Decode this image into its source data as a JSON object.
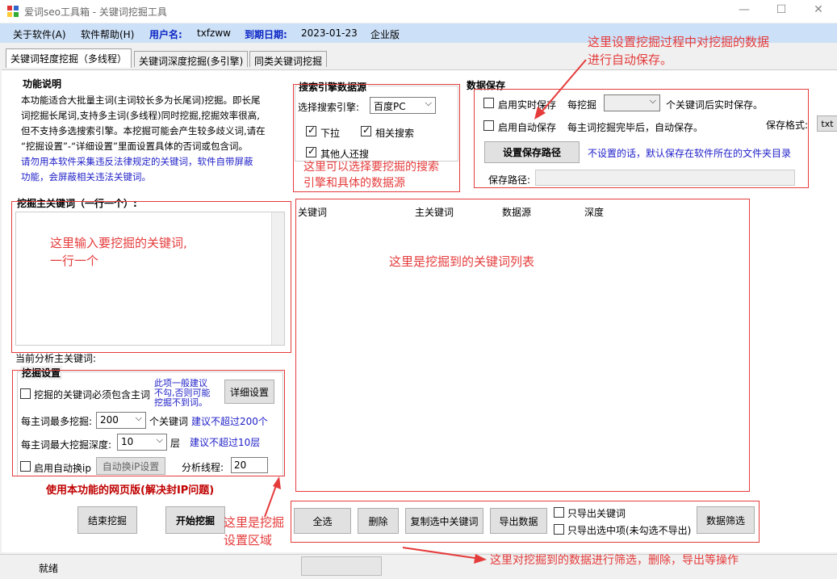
{
  "window": {
    "title": "爱词seo工具箱 - 关键词挖掘工具"
  },
  "menu": {
    "about": "关于软件(A)",
    "help": "软件帮助(H)",
    "user_label": "用户名:",
    "user": "txfzww",
    "expire_label": "到期日期:",
    "expire": "2023-01-23",
    "edition": "企业版"
  },
  "tabs": [
    "关键词轻度挖掘（多线程）",
    "关键词深度挖掘(多引擎)",
    "同类关键词挖掘"
  ],
  "func": {
    "title": "功能说明",
    "lines": [
      "本功能适合大批量主词(主词较长多为长尾词)挖掘。即长尾",
      "词挖掘长尾词,支持多主词(多线程)同时挖掘,挖掘效率很高,",
      "但不支持多选搜索引擎。本挖掘可能会产生较多歧义词,请在",
      "“挖掘设置”-“详细设置”里面设置具体的否词或包含词。"
    ],
    "warn": [
      "请勿用本软件采集违反法律规定的关键词，软件自带屏蔽",
      "功能，会屏蔽相关违法关键词。"
    ]
  },
  "engine": {
    "title": "搜索引擎数据源",
    "select_label": "选择搜索引擎:",
    "select_value": "百度PC",
    "cb1": "下拉",
    "cb2": "相关搜索",
    "cb3": "其他人还搜"
  },
  "save": {
    "title": "数据保存",
    "realtime": "启用实时保存",
    "every": "每挖掘",
    "after": "个关键词后实时保存。",
    "auto": "启用自动保存",
    "auto_desc": "每主词挖掘完毕后，自动保存。",
    "format_label": "保存格式:",
    "format": "txt",
    "set_path": "设置保存路径",
    "note": "不设置的话，默认保存在软件所在的文件夹目录",
    "path_label": "保存路径:"
  },
  "input": {
    "title": "挖掘主关键词（一行一个）:",
    "current": "当前分析主关键词:"
  },
  "settings": {
    "title": "挖掘设置",
    "must_contain": "挖掘的关键词必须包含主词",
    "hint": [
      "此项一般建议",
      "不勾,否则可能",
      "挖掘不到词。"
    ],
    "detail": "详细设置",
    "max_label": "每主词最多挖掘:",
    "max_value": "200",
    "max_unit": "个关键词",
    "max_tip": "建议不超过200个",
    "depth_label": "每主词最大挖掘深度:",
    "depth_value": "10",
    "depth_unit": "层",
    "depth_tip": "建议不超过10层",
    "ip": "启用自动换ip",
    "ip_btn": "自动换iP设置",
    "threads_label": "分析线程:",
    "threads": "20",
    "web": "使用本功能的网页版(解决封IP问题)"
  },
  "table": {
    "cols": [
      "关键词",
      "主关键词",
      "数据源",
      "深度"
    ]
  },
  "actions": {
    "select_all": "全选",
    "delete": "删除",
    "copy": "复制选中关键词",
    "export": "导出数据",
    "only_kw": "只导出关键词",
    "only_sel": "只导出选中项(未勾选不导出)",
    "filter": "数据筛选",
    "stop": "结束挖掘",
    "start": "开始挖掘"
  },
  "status": {
    "text": "就绪"
  },
  "annot": {
    "save": [
      "这里设置挖掘过程中对挖掘的数据",
      "进行自动保存。"
    ],
    "engine": [
      "这里可以选择要挖掘的搜索",
      "引擎和具体的数据源"
    ],
    "input": [
      "这里输入要挖掘的关键词,",
      "一行一个"
    ],
    "list": "这里是挖掘到的关键词列表",
    "settings": [
      "这里是挖掘",
      "设置区域"
    ],
    "ops": "这里对挖掘到的数据进行筛选，删除，导出等操作"
  }
}
